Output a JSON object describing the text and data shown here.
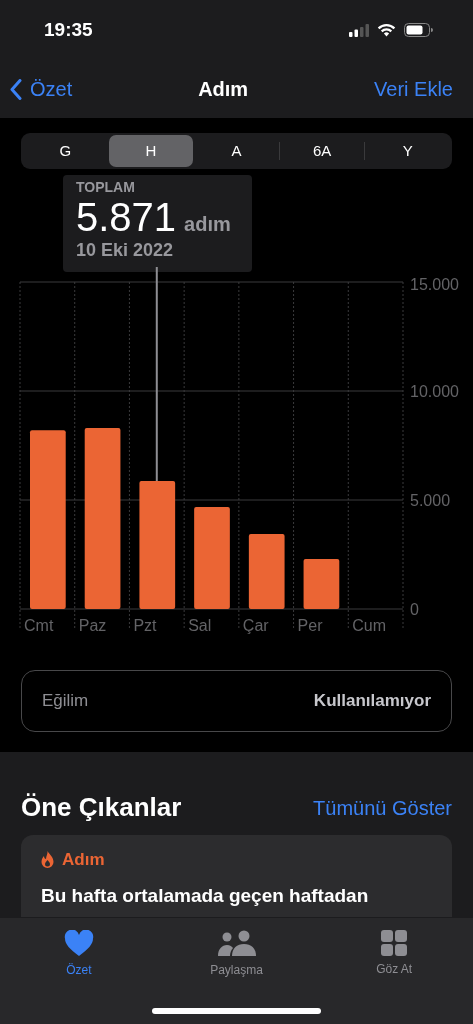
{
  "status_bar": {
    "time": "19:35"
  },
  "nav": {
    "back": "Özet",
    "title": "Adım",
    "action": "Veri Ekle"
  },
  "segments": [
    {
      "label": "G",
      "selected": false
    },
    {
      "label": "H",
      "selected": true
    },
    {
      "label": "A",
      "selected": false
    },
    {
      "label": "6A",
      "selected": false
    },
    {
      "label": "Y",
      "selected": false
    }
  ],
  "tooltip": {
    "label": "TOPLAM",
    "value": "5.871",
    "unit": "adım",
    "date": "10 Eki 2022"
  },
  "chart_data": {
    "type": "bar",
    "categories": [
      "Cmt",
      "Paz",
      "Pzt",
      "Sal",
      "Çar",
      "Per",
      "Cum"
    ],
    "series": [
      {
        "color": "#eb6534",
        "values": [
          8200,
          8300,
          5871,
          4680,
          3440,
          2290,
          null
        ]
      }
    ],
    "ylim": [
      0,
      15000
    ],
    "yticks": [
      {
        "value": 0,
        "label": "0"
      },
      {
        "value": 5000,
        "label": "5.000"
      },
      {
        "value": 10000,
        "label": "10.000"
      },
      {
        "value": 15000,
        "label": "15.000"
      }
    ],
    "annotations": [
      {
        "x": "Pzt"
      }
    ]
  },
  "trend": {
    "label": "Eğilim",
    "value": "Kullanılamıyor"
  },
  "highlights": {
    "title": "Öne Çıkanlar",
    "link": "Tümünü Göster",
    "card": {
      "category": "Adım",
      "text": "Bu hafta ortalamada geçen haftadan"
    }
  },
  "tab_bar": [
    {
      "label": "Özet",
      "selected": true
    },
    {
      "label": "Paylaşma",
      "selected": false
    },
    {
      "label": "Göz At",
      "selected": false
    }
  ]
}
